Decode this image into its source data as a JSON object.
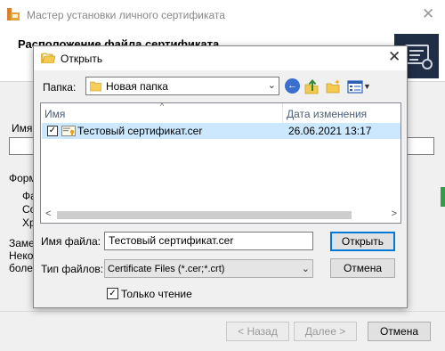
{
  "wizard": {
    "title": "Мастер установки личного сертификата",
    "header_title": "Расположение файла сертификата",
    "partial_labels": [
      "Имя",
      "Форм",
      "Фа",
      "Со",
      "Хр",
      "Заме",
      "Неко",
      "более"
    ],
    "back_label": "< Назад",
    "next_label": "Далее >",
    "cancel_label": "Отмена"
  },
  "dialog": {
    "title": "Открыть",
    "folder_label": "Папка:",
    "folder_value": "Новая папка",
    "columns": {
      "name": "Имя",
      "date": "Дата изменения"
    },
    "files": [
      {
        "name": "Тестовый сертификат.cer",
        "date": "26.06.2021 13:17",
        "checked": true
      }
    ],
    "filename_label": "Имя файла:",
    "filename_value": "Тестовый сертификат.cer",
    "filetype_label": "Тип файлов:",
    "filetype_value": "Certificate Files (*.cer;*.crt)",
    "open_label": "Открыть",
    "cancel_label": "Отмена",
    "readonly_label": "Только чтение",
    "readonly_checked": true,
    "check_glyph": "✓",
    "icons": {
      "back": "back-arrow-icon",
      "up": "up-folder-icon",
      "new_folder": "new-folder-icon",
      "view": "view-menu-icon"
    }
  },
  "colors": {
    "selection": "#cce8ff",
    "accent": "#0078d7",
    "header_text": "#4c607a"
  }
}
